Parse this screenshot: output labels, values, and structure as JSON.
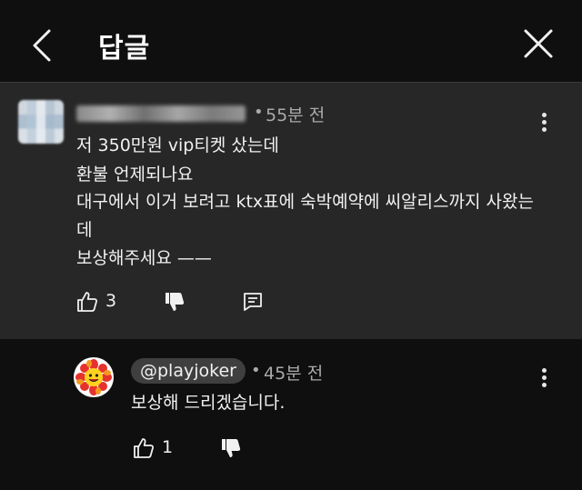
{
  "header": {
    "title": "답글",
    "back_icon": "chevron-left-icon",
    "close_icon": "close-icon"
  },
  "comment": {
    "time": "55분 전",
    "lines": [
      "저 350만원 vip티켓 샀는데",
      "환불 언제되나요",
      "대구에서 이거 보려고 ktx표에 숙박예약에 씨알리스까지 사왔는",
      "데",
      "보상해주세요 ——"
    ],
    "like_count": "3",
    "icons": [
      "thumbs-up-icon",
      "thumbs-down-icon",
      "reply-icon",
      "more-vert-icon"
    ]
  },
  "reply": {
    "handle": "@playjoker",
    "time": "45분 전",
    "text": "보상해 드리겠습니다.",
    "like_count": "1",
    "icons": [
      "thumbs-up-icon",
      "thumbs-down-icon",
      "more-vert-icon"
    ]
  },
  "colors": {
    "background": "#0f0f0f",
    "comment_background": "#272727",
    "text": "#f1f1f1",
    "meta": "#aaaaaa"
  }
}
